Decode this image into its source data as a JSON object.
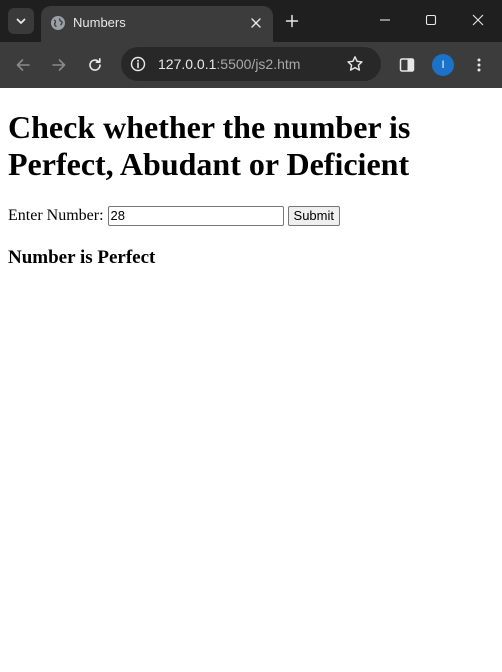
{
  "tab": {
    "title": "Numbers"
  },
  "toolbar": {
    "url_host": "127.0.0.1",
    "url_path": ":5500/js2.htm",
    "profile_initial": "I"
  },
  "page": {
    "heading": "Check whether the number is Perfect, Abudant or Deficient",
    "input_label": "Enter Number:",
    "input_value": "28",
    "submit_label": "Submit",
    "result": "Number is Perfect"
  },
  "colors": {
    "frame": "#1f1f1f",
    "toolbar": "#3c3c3c",
    "omnibox": "#282828",
    "profile_avatar": "#1a73c9",
    "page_background": "#ffffff"
  },
  "icons": {
    "tab_search": "chevron-down-icon",
    "favicon": "globe-icon",
    "tab_close": "close-icon",
    "new_tab": "plus-icon",
    "window_minimize": "minimize-icon",
    "window_maximize": "maximize-icon",
    "window_close": "close-icon",
    "back": "arrow-left-icon",
    "forward": "arrow-right-icon",
    "reload": "reload-icon",
    "site_info": "info-icon",
    "bookmark": "star-icon",
    "side_panel": "side-panel-icon",
    "menu": "kebab-menu-icon"
  }
}
